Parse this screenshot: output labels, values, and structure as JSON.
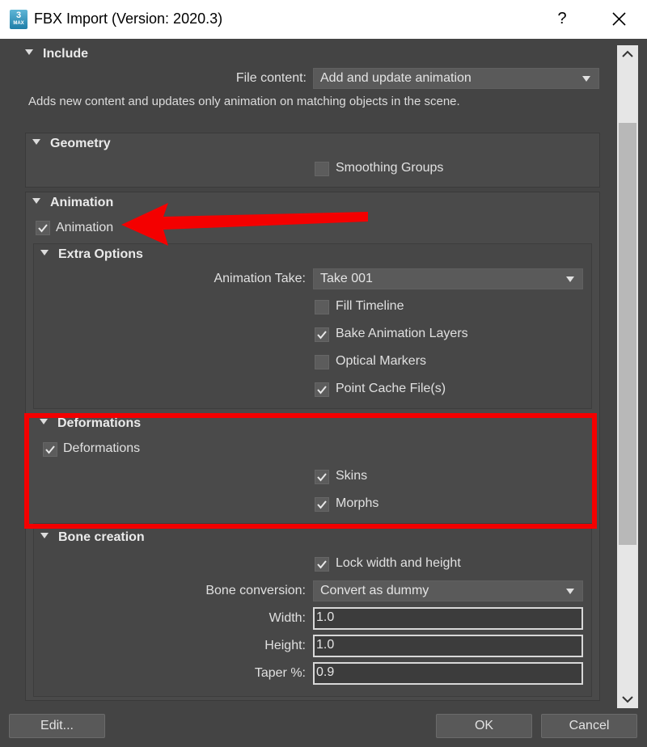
{
  "window": {
    "title": "FBX Import (Version: 2020.3)",
    "icon_label": "3",
    "icon_sublabel": "MAX",
    "help_label": "?"
  },
  "include": {
    "header": "Include",
    "file_content_label": "File content:",
    "file_content_value": "Add and update animation",
    "description": "Adds new content and updates only animation on matching objects in the scene."
  },
  "geometry": {
    "header": "Geometry",
    "smoothing_groups": {
      "label": "Smoothing Groups",
      "checked": false
    }
  },
  "animation": {
    "header": "Animation",
    "animation_cb": {
      "label": "Animation",
      "checked": true
    },
    "extra_options": {
      "header": "Extra Options",
      "take_label": "Animation Take:",
      "take_value": "Take 001",
      "fill_timeline": {
        "label": "Fill Timeline",
        "checked": false
      },
      "bake_layers": {
        "label": "Bake Animation Layers",
        "checked": true
      },
      "optical_markers": {
        "label": "Optical Markers",
        "checked": false
      },
      "point_cache": {
        "label": "Point Cache File(s)",
        "checked": true
      }
    },
    "deformations": {
      "header": "Deformations",
      "deformations_cb": {
        "label": "Deformations",
        "checked": true
      },
      "skins": {
        "label": "Skins",
        "checked": true
      },
      "morphs": {
        "label": "Morphs",
        "checked": true
      }
    },
    "bone_creation": {
      "header": "Bone creation",
      "lock_wh": {
        "label": "Lock width and height",
        "checked": true
      },
      "conversion_label": "Bone conversion:",
      "conversion_value": "Convert as dummy",
      "width_label": "Width:",
      "width_value": "1.0",
      "height_label": "Height:",
      "height_value": "1.0",
      "taper_label": "Taper %:",
      "taper_value": "0.9"
    }
  },
  "footer": {
    "edit_label": "Edit...",
    "ok_label": "OK",
    "cancel_label": "Cancel"
  },
  "colors": {
    "background": "#444444",
    "annotation_red": "#f40000"
  }
}
